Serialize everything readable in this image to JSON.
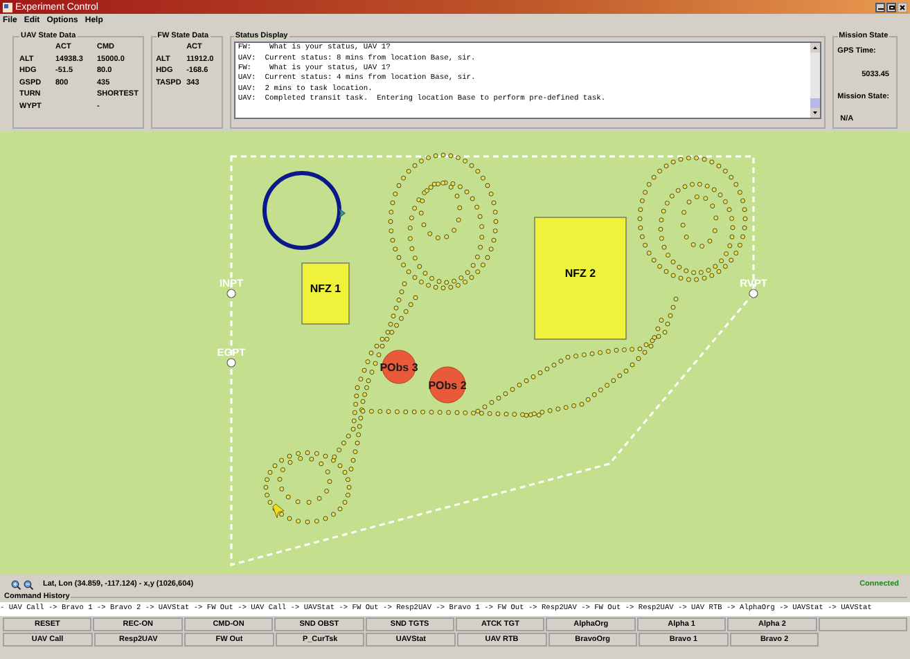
{
  "window": {
    "title": "Experiment Control"
  },
  "menu": [
    "File",
    "Edit",
    "Options",
    "Help"
  ],
  "uav_state": {
    "title": "UAV State Data",
    "columns": [
      "ACT",
      "CMD"
    ],
    "rows": [
      {
        "label": "ALT",
        "act": "14938.3",
        "cmd": "15000.0"
      },
      {
        "label": "HDG",
        "act": "-51.5",
        "cmd": "80.0"
      },
      {
        "label": "GSPD",
        "act": "800",
        "cmd": "435"
      },
      {
        "label": "TURN",
        "cmd": "SHORTEST"
      },
      {
        "label": "WYPT",
        "cmd": "-"
      }
    ]
  },
  "fw_state": {
    "title": "FW State Data",
    "columns": [
      "ACT"
    ],
    "rows": [
      {
        "label": "ALT",
        "act": "11912.0"
      },
      {
        "label": "HDG",
        "act": "-168.6"
      },
      {
        "label": "TASPD",
        "act": "343"
      }
    ]
  },
  "status_display": {
    "title": "Status Display",
    "lines": [
      "FW:    What is your status, UAV 1?",
      "UAV:  Current status: 8 mins from location Base, sir.",
      "FW:    What is your status, UAV 1?",
      "UAV:  Current status: 4 mins from location Base, sir.",
      "UAV:  2 mins to task location.",
      "UAV:  Completed transit task.  Entering location Base to perform pre-defined task."
    ]
  },
  "mission_state": {
    "title": "Mission State",
    "gps_label": "GPS Time:",
    "gps_time": "5033.45",
    "state_label": "Mission State:",
    "state": "N/A"
  },
  "map": {
    "waypoints": [
      {
        "label": "INPT"
      },
      {
        "label": "EGPT"
      },
      {
        "label": "RVPT"
      }
    ],
    "zones": [
      {
        "label": "NFZ 1"
      },
      {
        "label": "NFZ 2"
      }
    ],
    "obstacles": [
      {
        "label": "PObs 3"
      },
      {
        "label": "PObs 2"
      }
    ]
  },
  "coordinates": "Lat, Lon (34.859, -117.124) - x,y (1026,604)",
  "connection": "Connected",
  "command_history": {
    "title": "Command History",
    "text": "- UAV Call -> Bravo 1 -> Bravo 2 -> UAVStat -> FW Out -> UAV Call -> UAVStat -> FW Out -> Resp2UAV -> Bravo 1 -> FW Out -> Resp2UAV -> FW Out -> Resp2UAV -> UAV RTB -> AlphaOrg -> UAVStat -> UAVStat"
  },
  "button_rows": [
    {
      "labels": [
        "RESET",
        "REC-ON",
        "CMD-ON",
        "SND OBST",
        "SND TGTS",
        "ATCK TGT",
        "AlphaOrg",
        "Alpha 1",
        "Alpha 2"
      ],
      "blank_button_at_end": true
    },
    {
      "labels": [
        "UAV Call",
        "Resp2UAV",
        "FW Out",
        "P_CurTsk",
        "UAVStat",
        "UAV RTB",
        "BravoOrg",
        "Bravo 1",
        "Bravo 2"
      ],
      "blank_button_at_end": false
    }
  ]
}
